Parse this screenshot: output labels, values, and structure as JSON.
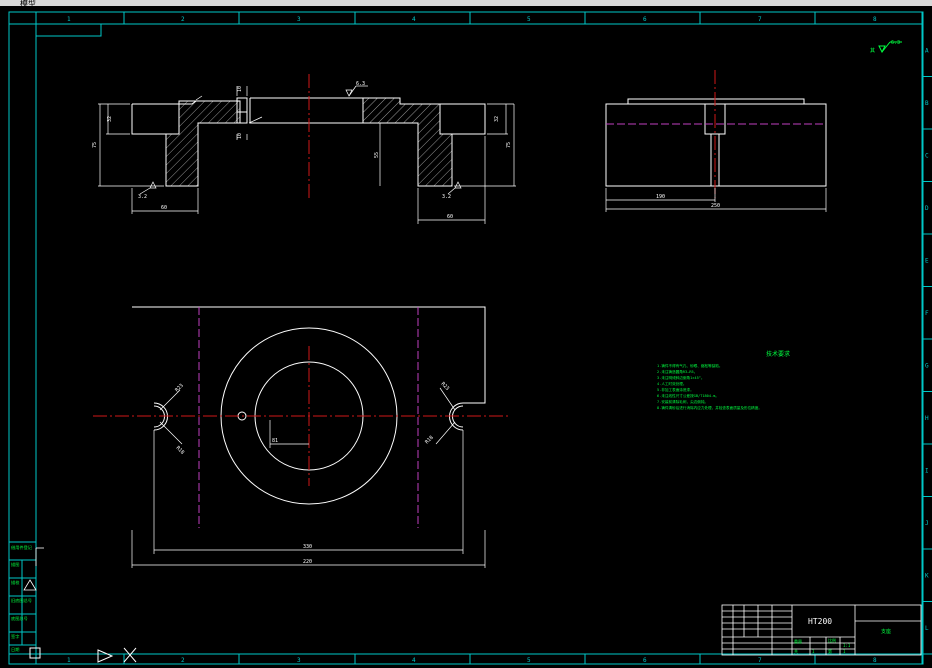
{
  "window": {
    "title_fragment": "模型"
  },
  "colors": {
    "background": "#000000",
    "geometry": "#ffffff",
    "frame": "#00c8c8",
    "center_line": "#d01818",
    "hidden_line": "#c040c0",
    "dimension": "#ffffff",
    "annotation": "#00ff40",
    "hatch": "#ffffff"
  },
  "zone_columns": [
    "1",
    "2",
    "3",
    "4",
    "5",
    "6",
    "7",
    "8"
  ],
  "zone_rows": [
    "A",
    "B",
    "C",
    "D",
    "E",
    "F",
    "G",
    "H",
    "I",
    "J",
    "K",
    "L"
  ],
  "corner_roughness": "6.3",
  "front_view": {
    "surface_marks": [
      "6.3",
      "3.2",
      "3.2"
    ],
    "dims": {
      "left_total_height": "75",
      "left_flange": "32",
      "right_flange": "32",
      "right_total_height": "75",
      "slot_width": "10",
      "slot_depth": "10",
      "inner_height": "55",
      "left_width": "60",
      "right_width": "60"
    }
  },
  "side_view": {
    "dims": {
      "half_width": "190",
      "total_width": "250"
    }
  },
  "top_view": {
    "dims": {
      "inner_length": "330",
      "overall_length": "220",
      "offset": "81",
      "left_radius_a": "R23",
      "left_radius_b": "R18",
      "right_radius_a": "R23",
      "right_radius_b": "R18"
    }
  },
  "technical_requirements": {
    "title": "技术要求",
    "lines": [
      "1.铸件不得有气孔、砂眼、缩松等缺陷。",
      "2.未注铸造圆角R3—R5。",
      "3.未注明倾斜边倒角1×45°。",
      "4.人工时效处理。",
      "5.非加工表面涂底漆。",
      "6.未注线性尺寸公差按GB/T1804-m。",
      "7.安装前清除毛刺，尖边倒钝。",
      "8.铸件清砂后进行消除内应力处理，并检查表面质量及形位精度。"
    ]
  },
  "title_block": {
    "material": "HT200",
    "drawing_name": "支座",
    "scale_label": "比例",
    "scale": "1:1",
    "sheet_label": "共",
    "sheet_of": "第",
    "count_a": "1",
    "count_b": "1",
    "weight_label": "重量"
  },
  "side_labels": [
    "借用件登记",
    "描图",
    "描校",
    "旧底图总号",
    "底图总号",
    "签字",
    "日期"
  ]
}
